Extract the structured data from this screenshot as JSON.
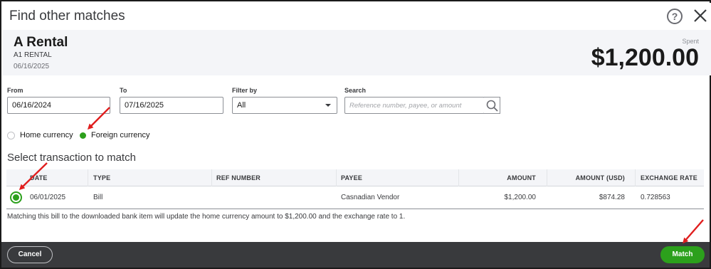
{
  "dialog": {
    "title": "Find other matches"
  },
  "header": {
    "payee_name": "A Rental",
    "payee_sub": "A1 RENTAL",
    "date": "06/16/2025",
    "spent_label": "Spent",
    "spent_amount": "$1,200.00"
  },
  "filters": {
    "from_label": "From",
    "from_value": "06/16/2024",
    "to_label": "To",
    "to_value": "07/16/2025",
    "filter_label": "Filter by",
    "filter_value": "All",
    "search_label": "Search",
    "search_placeholder": "Reference number, payee, or amount"
  },
  "currency": {
    "home_label": "Home currency",
    "foreign_label": "Foreign currency",
    "selected": "foreign"
  },
  "section_title": "Select transaction to match",
  "table": {
    "headers": {
      "date": "DATE",
      "type": "TYPE",
      "ref": "REF NUMBER",
      "payee": "PAYEE",
      "amount": "AMOUNT",
      "amount_usd": "AMOUNT (USD)",
      "rate": "EXCHANGE RATE"
    },
    "rows": [
      {
        "date": "06/01/2025",
        "type": "Bill",
        "ref": "",
        "payee": "Casnadian Vendor",
        "amount": "$1,200.00",
        "amount_usd": "$874.28",
        "rate": "0.728563",
        "selected": true
      }
    ]
  },
  "note": "Matching this bill to the downloaded bank item will update the home currency amount to $1,200.00 and the exchange rate to 1.",
  "footer": {
    "cancel_label": "Cancel",
    "match_label": "Match"
  },
  "colors": {
    "accent": "#2ca01c",
    "footer_bg": "#393a3d",
    "annotation_arrow": "#e01e1e"
  }
}
